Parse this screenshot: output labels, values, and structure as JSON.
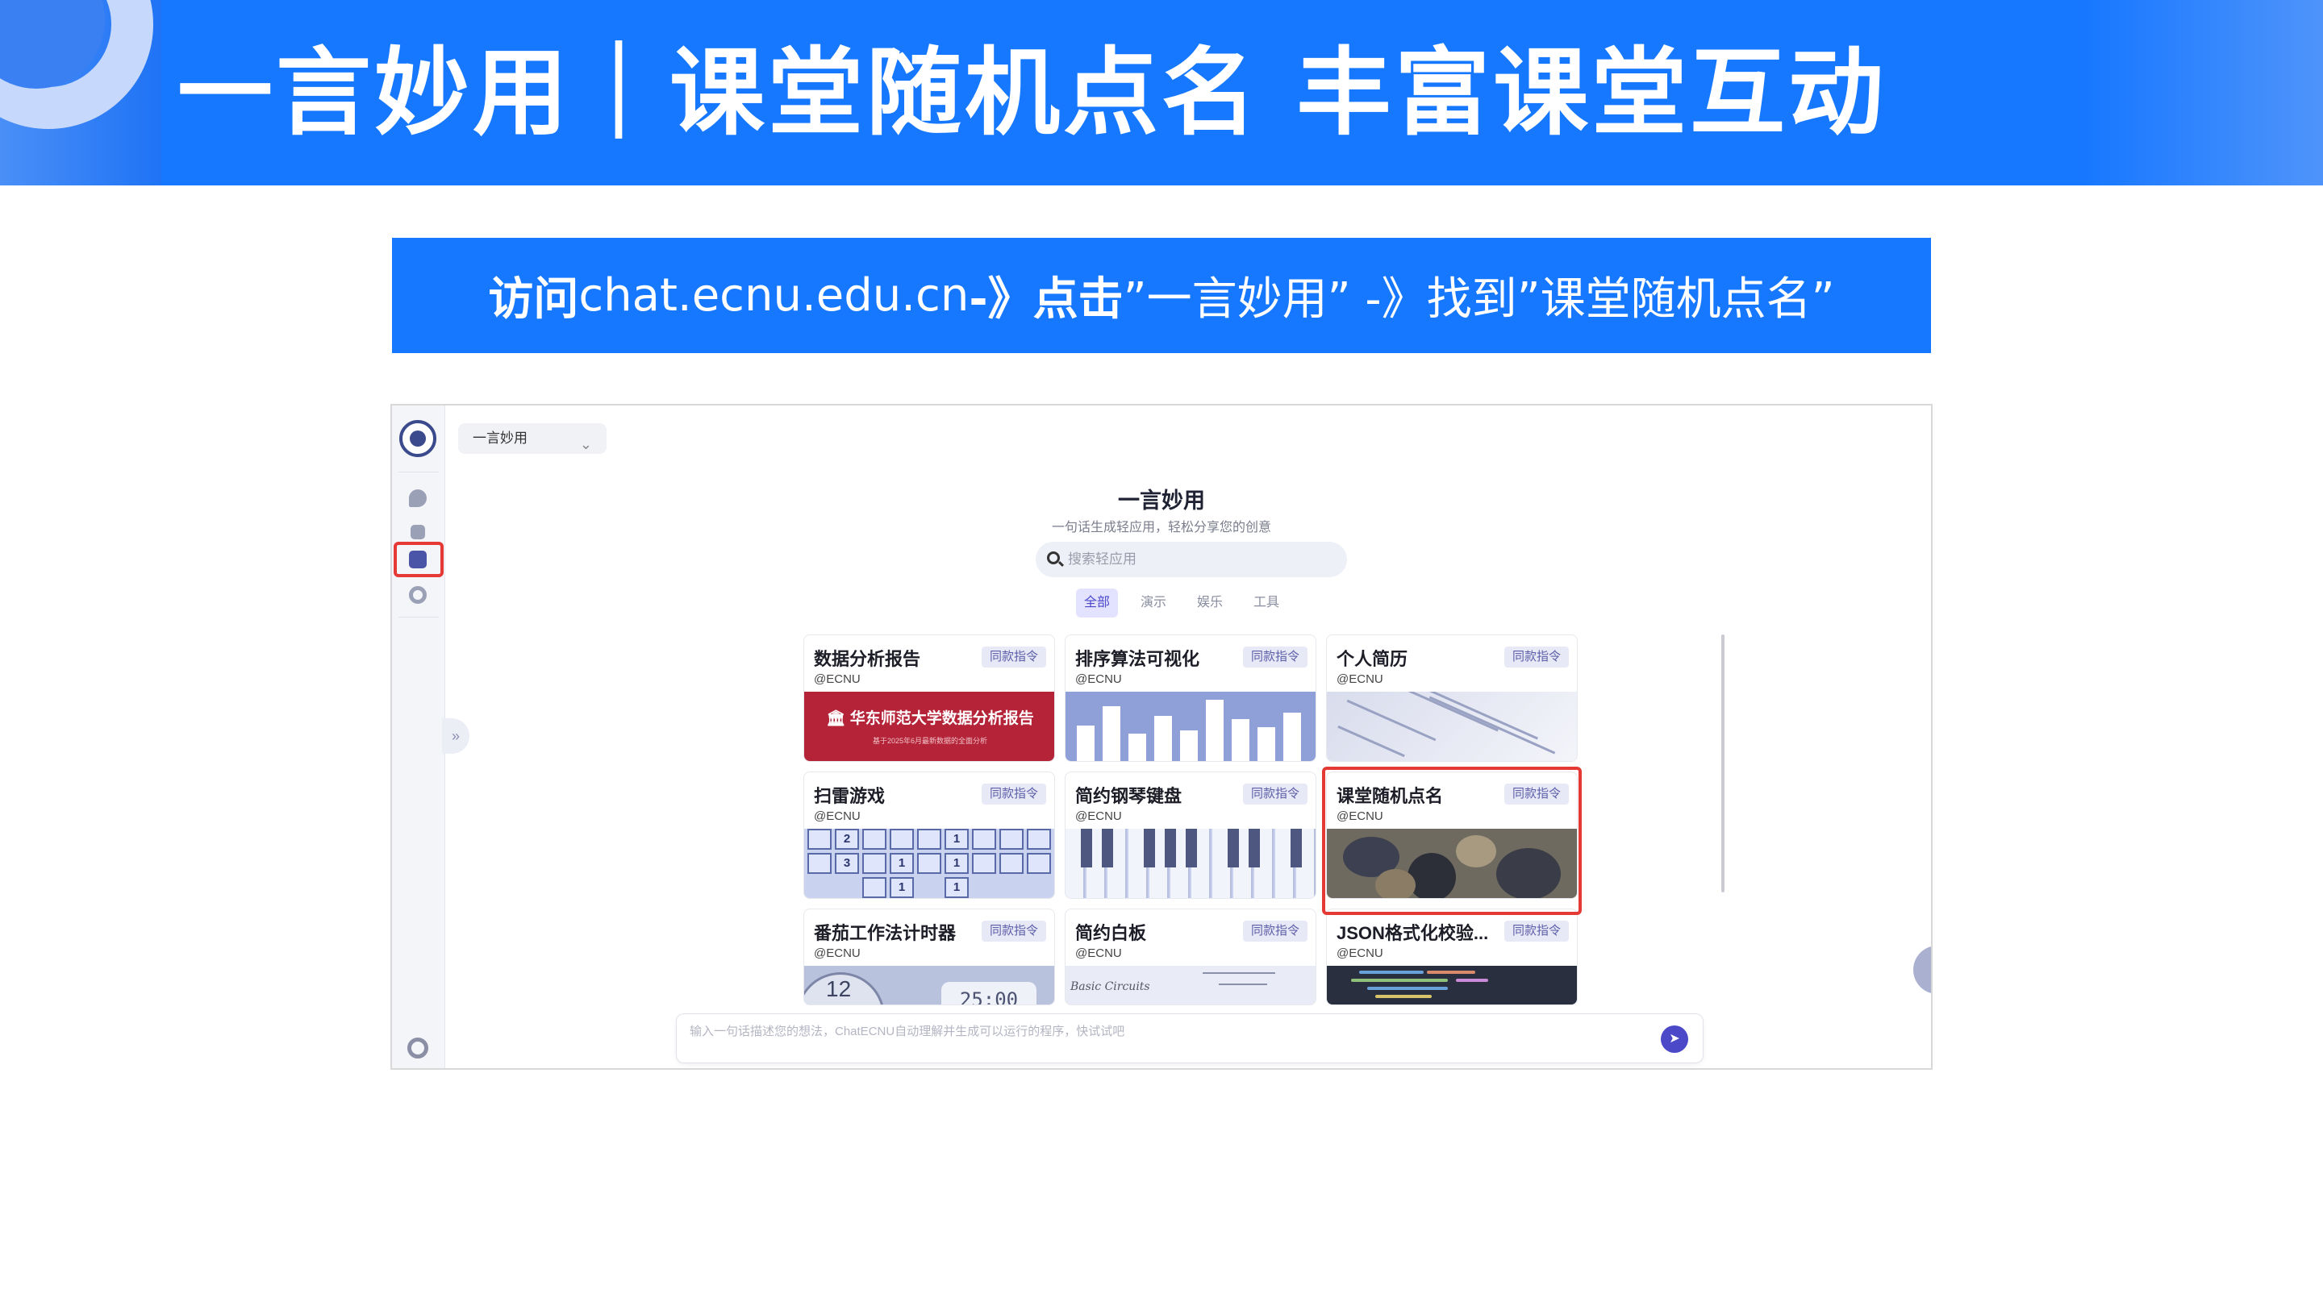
{
  "slide": {
    "title": "一言妙用｜课堂随机点名 丰富课堂互动",
    "instruction": {
      "part1_bold": "访问",
      "part2": "chat.ecnu.edu.cn ",
      "part3_bold": "-》点击",
      "part4": "”一言妙用” -》找到”课堂随机点名”"
    }
  },
  "colors": {
    "brand_blue": "#1677ff",
    "highlight_red": "#e53935",
    "accent_purple": "#4b49c8"
  },
  "app": {
    "dropdown_label": "一言妙用",
    "title": "一言妙用",
    "subtitle": "一句话生成轻应用，轻松分享您的创意",
    "search_placeholder": "搜索轻应用",
    "tabs": [
      "全部",
      "演示",
      "娱乐",
      "工具"
    ],
    "active_tab": "全部",
    "cards": [
      {
        "title": "数据分析报告",
        "tag": "同款指令",
        "author": "@ECNU",
        "thumb": "report",
        "thumb_text": "华东师范大学数据分析报告",
        "thumb_sub": "基于2025年6月最新数据的全面分析"
      },
      {
        "title": "排序算法可视化",
        "tag": "同款指令",
        "author": "@ECNU",
        "thumb": "bars"
      },
      {
        "title": "个人简历",
        "tag": "同款指令",
        "author": "@ECNU",
        "thumb": "resume"
      },
      {
        "title": "扫雷游戏",
        "tag": "同款指令",
        "author": "@ECNU",
        "thumb": "minesweeper"
      },
      {
        "title": "简约钢琴键盘",
        "tag": "同款指令",
        "author": "@ECNU",
        "thumb": "piano"
      },
      {
        "title": "课堂随机点名",
        "tag": "同款指令",
        "author": "@ECNU",
        "thumb": "classroom",
        "highlighted": true
      },
      {
        "title": "番茄工作法计时器",
        "tag": "同款指令",
        "author": "@ECNU",
        "thumb": "timer",
        "timer_digits": "25:00",
        "clock_number": "12"
      },
      {
        "title": "简约白板",
        "tag": "同款指令",
        "author": "@ECNU",
        "thumb": "whiteboard",
        "board_text": "Basic Circuits"
      },
      {
        "title": "JSON格式化校验...",
        "tag": "同款指令",
        "author": "@ECNU",
        "thumb": "code"
      }
    ],
    "minesweeper_numbers": [
      "2",
      "1",
      "3",
      "1",
      "1",
      "1",
      "1"
    ],
    "composer_placeholder": "输入一句话描述您的想法，ChatECNU自动理解并生成可以运行的程序，快试试吧",
    "icons": {
      "logo": "university-seal-icon",
      "nav": [
        "chat-icon",
        "shapes-icon",
        "apps-icon",
        "circle-icon"
      ],
      "settings": "gear-icon",
      "expand": "double-chevron-right-icon",
      "search": "search-icon",
      "send": "send-icon"
    }
  }
}
